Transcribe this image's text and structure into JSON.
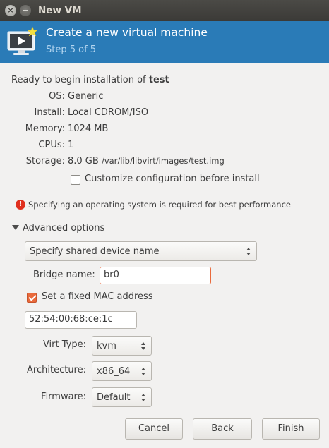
{
  "window": {
    "title": "New VM",
    "close_glyph": "×",
    "minimize_glyph": "−"
  },
  "banner": {
    "title": "Create a new virtual machine",
    "step": "Step 5 of 5",
    "icon": "vm-monitor-icon"
  },
  "summary": {
    "ready_prefix": "Ready to begin installation of ",
    "vm_name": "test",
    "os_label": "OS:",
    "os_value": "Generic",
    "install_label": "Install:",
    "install_value": "Local CDROM/ISO",
    "memory_label": "Memory:",
    "memory_value": "1024 MB",
    "cpus_label": "CPUs:",
    "cpus_value": "1",
    "storage_label": "Storage:",
    "storage_size": "8.0 GB",
    "storage_path": "/var/lib/libvirt/images/test.img"
  },
  "customize": {
    "label": "Customize configuration before install",
    "checked": false
  },
  "warning": {
    "icon": "error-icon",
    "text": "Specifying an operating system is required for best performance",
    "color": "#e0301e"
  },
  "advanced": {
    "label": "Advanced options",
    "expanded": true,
    "network_select": "Specify shared device name",
    "bridge_label": "Bridge name:",
    "bridge_value": "br0",
    "mac_checkbox_label": "Set a fixed MAC address",
    "mac_checked": true,
    "mac_value": "52:54:00:68:ce:1c",
    "virt_type_label": "Virt Type:",
    "virt_type_value": "kvm",
    "arch_label": "Architecture:",
    "arch_value": "x86_64",
    "firmware_label": "Firmware:",
    "firmware_value": "Default"
  },
  "buttons": {
    "cancel": "Cancel",
    "back": "Back",
    "finish": "Finish"
  },
  "colors": {
    "banner": "#2a7bb7",
    "accent": "#e96a3c",
    "titlebar": "#3c3b37"
  }
}
